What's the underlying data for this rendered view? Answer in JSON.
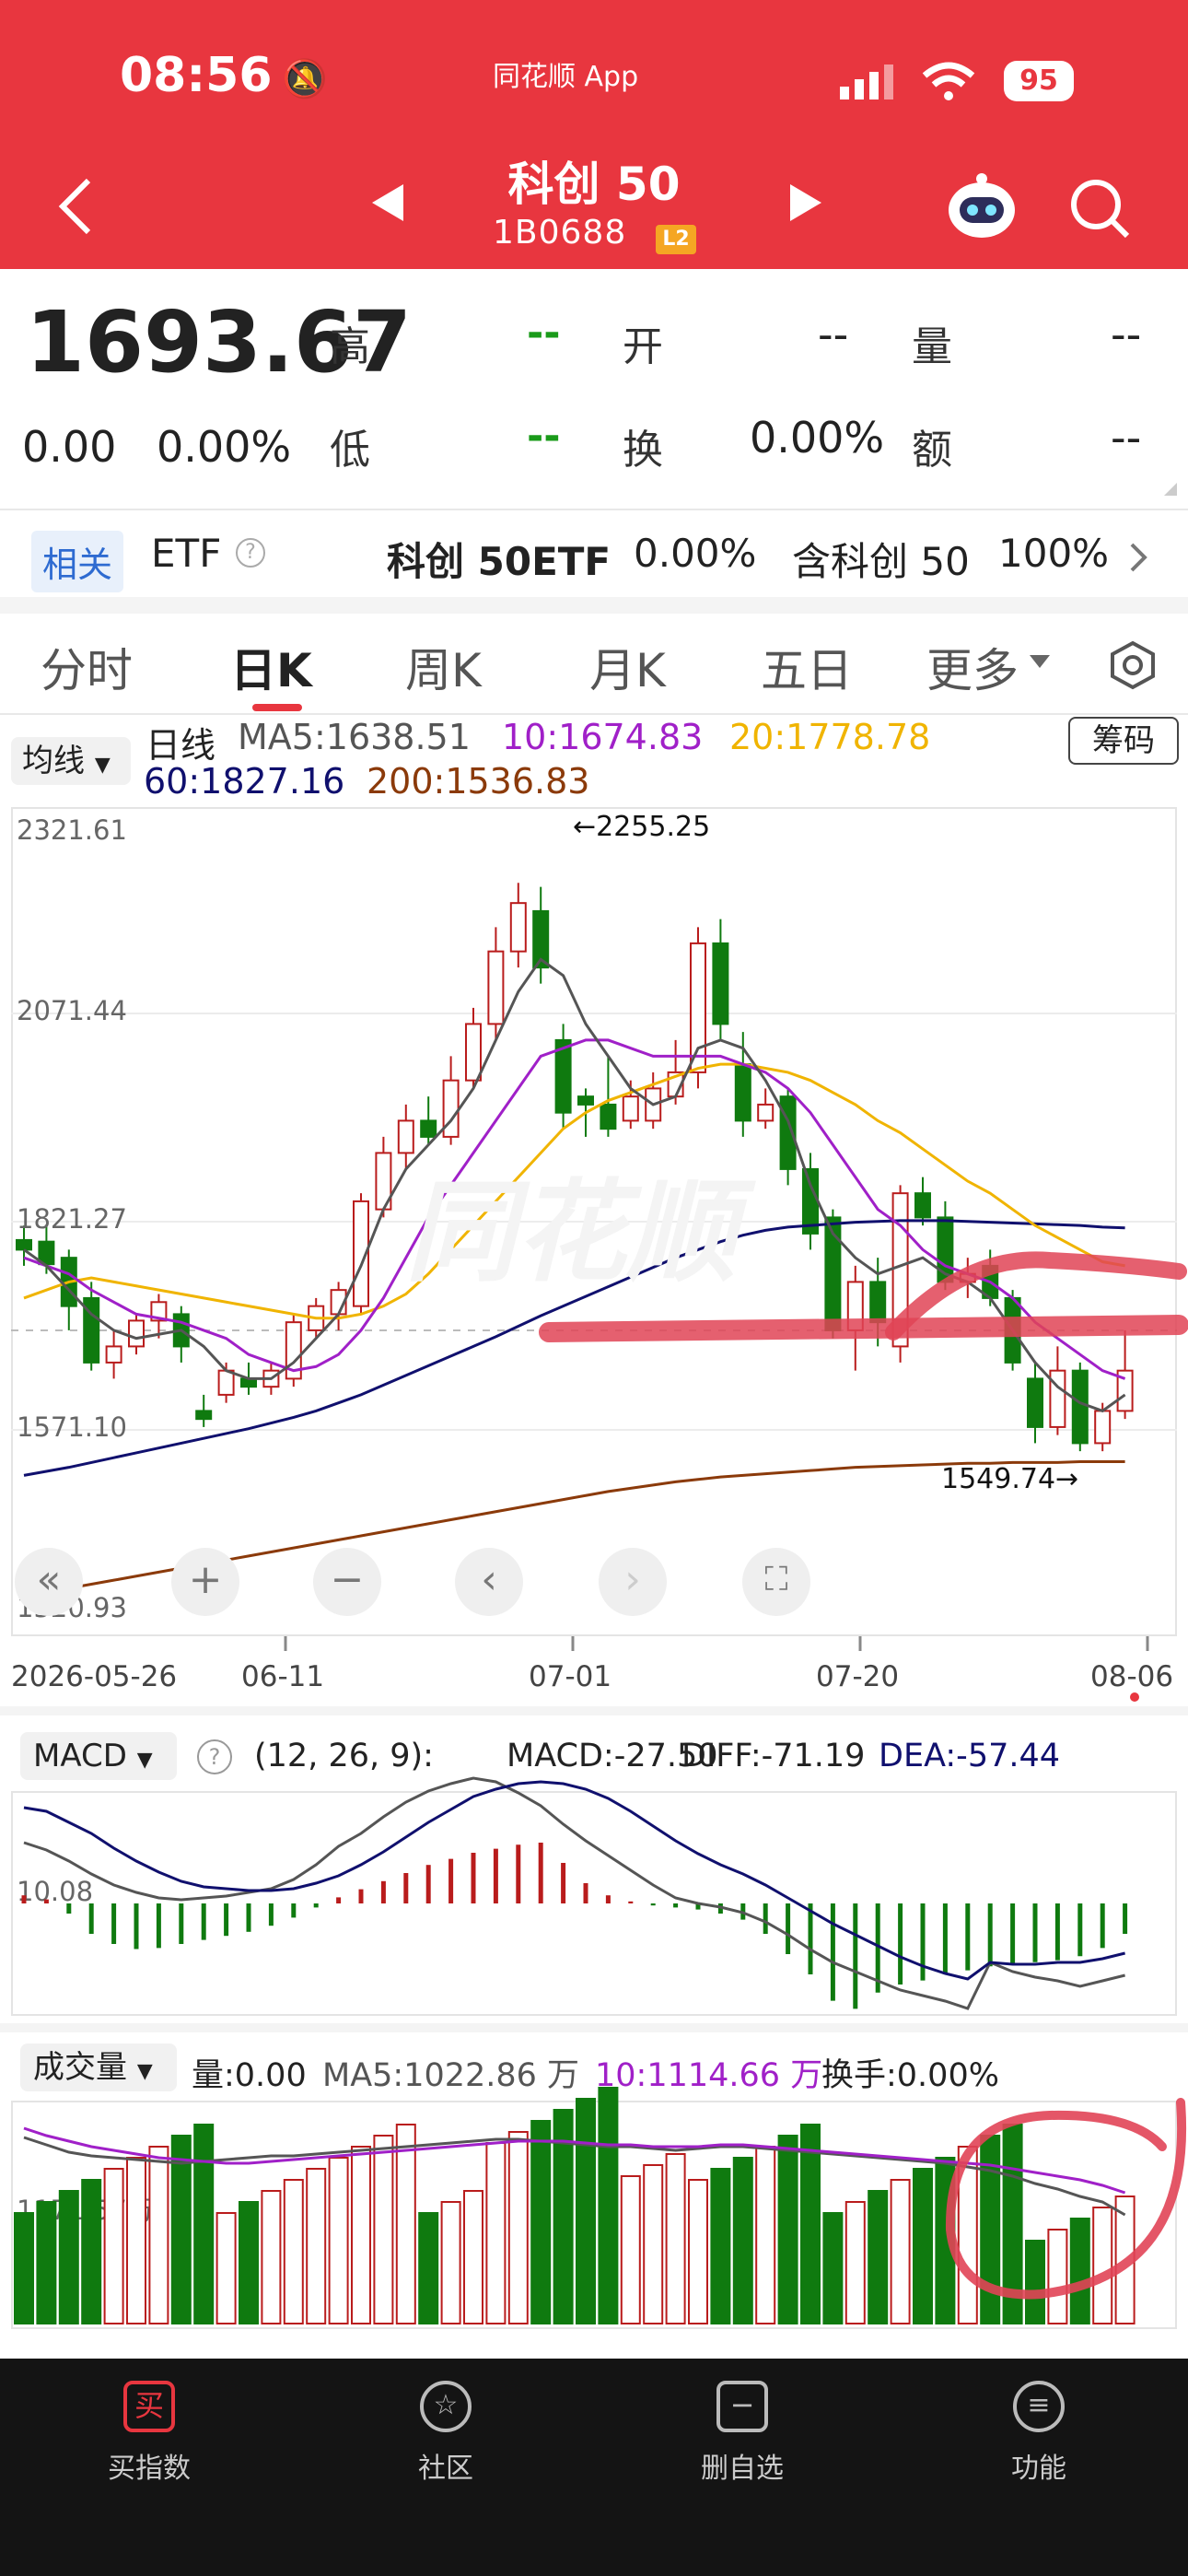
{
  "status": {
    "time": "08:56",
    "app": "同花顺 App",
    "battery": "95"
  },
  "nav": {
    "title": "科创 50",
    "code": "1B0688",
    "level_badge": "L2"
  },
  "quote": {
    "price": "1693.67",
    "change": "0.00",
    "change_pct": "0.00%",
    "high_label": "高",
    "high": "--",
    "open_label": "开",
    "open": "--",
    "volume_label": "量",
    "volume": "--",
    "low_label": "低",
    "low": "--",
    "turnover_label": "换",
    "turnover": "0.00%",
    "amount_label": "额",
    "amount": "--"
  },
  "related": {
    "badge": "相关",
    "type": "ETF",
    "etf_name": "科创 50ETF",
    "etf_change": "0.00%",
    "contains": "含科创 50",
    "contains_pct": "100%"
  },
  "tabs": [
    "分时",
    "日K",
    "周K",
    "月K",
    "五日",
    "更多"
  ],
  "legend": {
    "selector": "均线",
    "period": "日线",
    "ma5": "MA5:1638.51",
    "ma10": "10:1674.83",
    "ma20": "20:1778.78",
    "ma60": "60:1827.16",
    "ma200": "200:1536.83",
    "chip_button": "筹码"
  },
  "price_axis": [
    "2321.61",
    "2071.44",
    "1821.27",
    "1571.10",
    "1320.93"
  ],
  "annotations": {
    "high": "←2255.25",
    "low": "1549.74→"
  },
  "dates": [
    "2026-05-26",
    "06-11",
    "07-01",
    "07-20",
    "08-06"
  ],
  "macd": {
    "selector": "MACD",
    "params": "(12, 26, 9):",
    "macd": "MACD:-27.50",
    "diff": "DIFF:-71.19",
    "dea": "DEA:-57.44",
    "axis": "10.08"
  },
  "volume": {
    "selector": "成交量",
    "vol": "量:0.00",
    "ma5": "MA5:1022.86 万",
    "ma10": "10:1114.66 万",
    "turnover": "换手:0.00%",
    "axis": "1171.57万"
  },
  "colors": {
    "up": "#b91c1c",
    "down": "#0f7a0f",
    "ma5": "#555555",
    "ma10": "#a020c8",
    "ma20": "#f0b400",
    "ma60": "#10106e",
    "ma200": "#8b3a0a",
    "brand": "#e8363f"
  },
  "bottom_nav": [
    "买指数",
    "社区",
    "删自选",
    "功能"
  ],
  "chart_data": {
    "type": "candlestick",
    "x": [
      "2026-05-26",
      "06-11",
      "07-01",
      "07-20",
      "08-06"
    ],
    "ylim": [
      1320.93,
      2321.61
    ],
    "high_marker": 2255.25,
    "low_marker": 1549.74,
    "ma_values": {
      "MA5": 1638.51,
      "MA10": 1674.83,
      "MA20": 1778.78,
      "MA60": 1827.16,
      "MA200": 1536.83
    }
  }
}
